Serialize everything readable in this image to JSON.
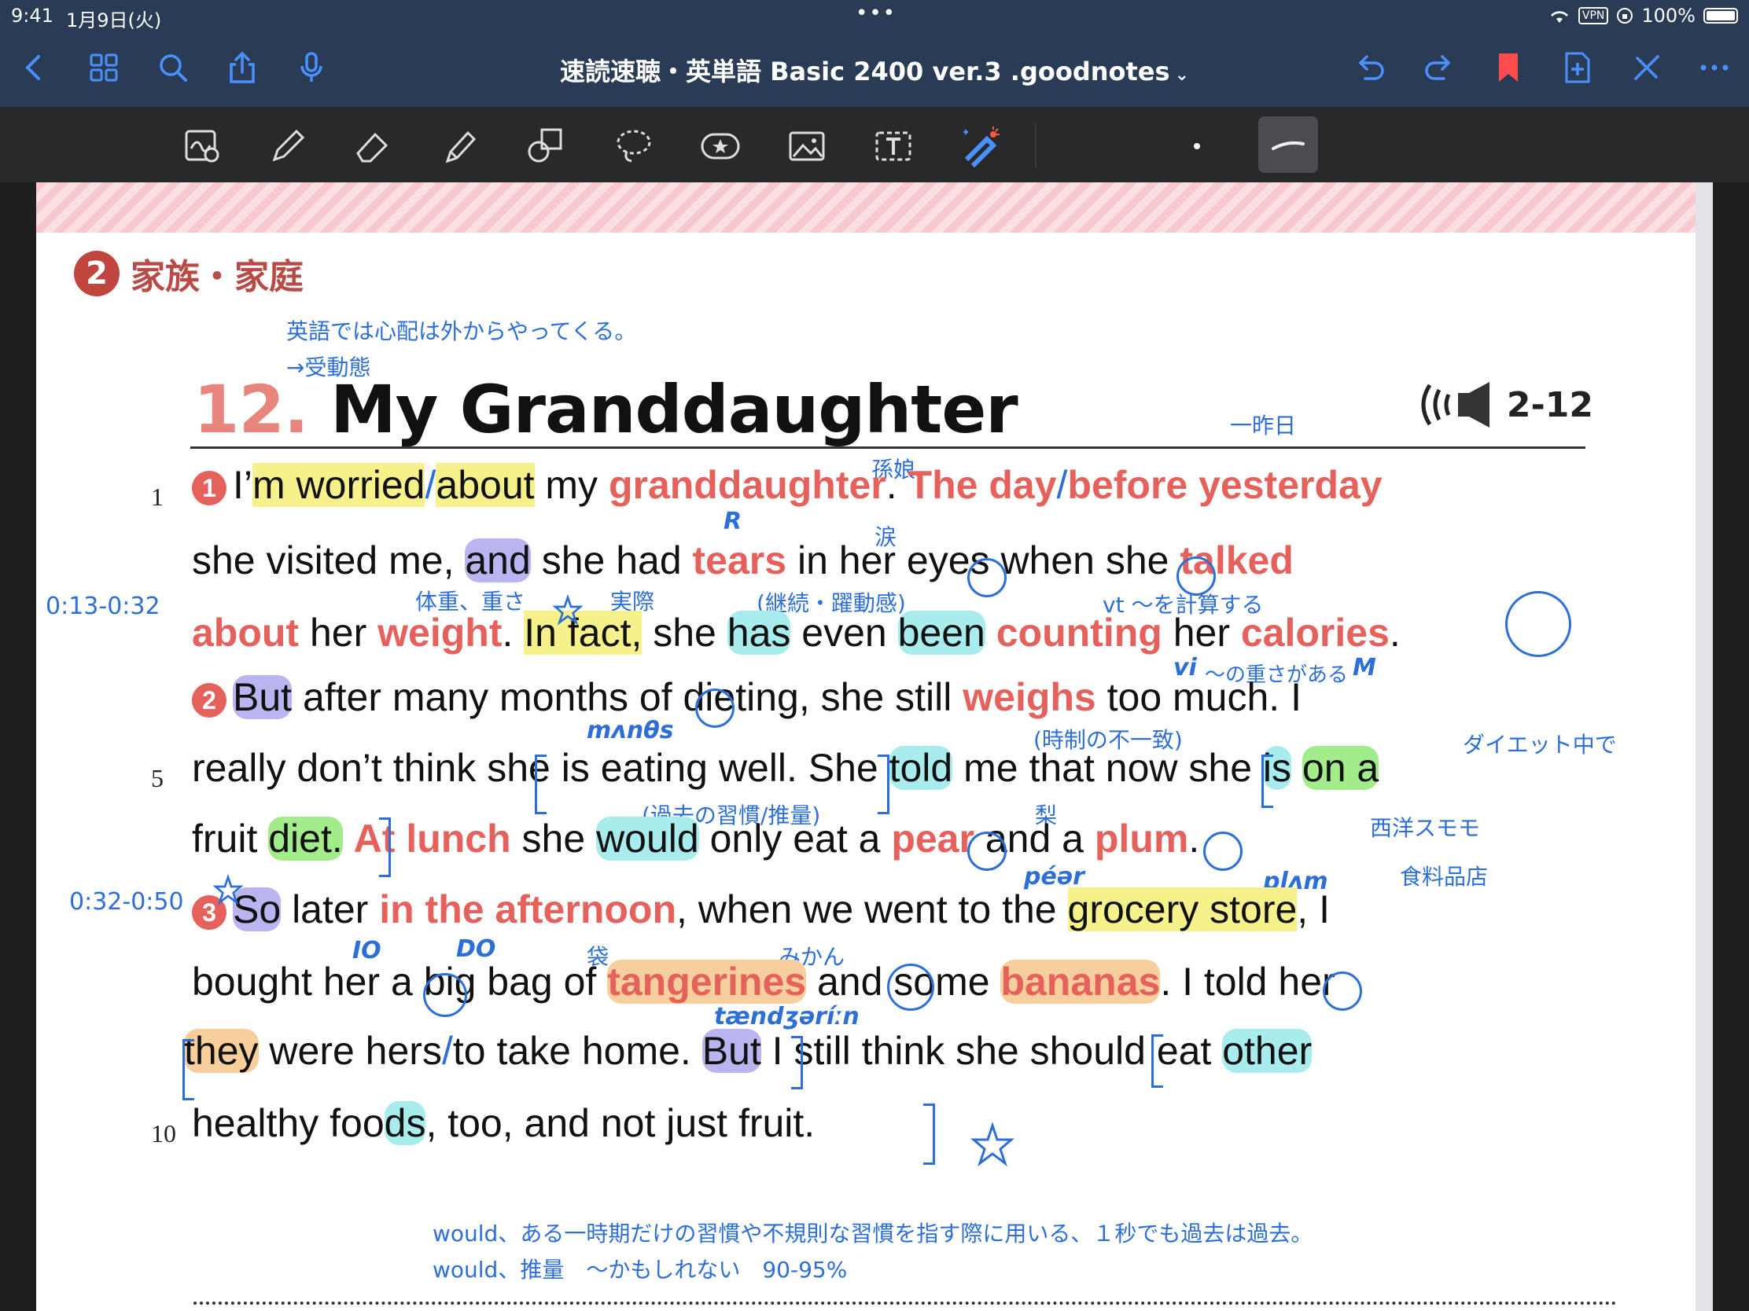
{
  "status": {
    "time": "9:41",
    "date": "1月9日(火)",
    "dots": "•••",
    "vpn": "VPN",
    "battery": "100%"
  },
  "nav": {
    "title": "速読速聴・英単語 Basic 2400 ver.3 .goodnotes",
    "title_chevron": "⌄"
  },
  "colors": {
    "accent": "#4a90ff",
    "bookmark": "#ff4d4d",
    "note_blue": "#2d6fd6",
    "red_word": "#e5615c"
  },
  "page": {
    "section_number": "2",
    "section_title": "家族・家庭",
    "note_top1": "英語では心配は外からやってくる。",
    "note_top2": "→受動態",
    "lesson_number": "12.",
    "lesson_title": "My Granddaughter",
    "audio_label": "2-12",
    "note_ototoi": "一昨日",
    "note_magomusume": "孫娘",
    "note_namida": "涙",
    "note_taiju": "体重、重さ",
    "note_jissai": "実際",
    "note_keizoku": "(継続・躍動感)",
    "note_keisan": "vt ～を計算する",
    "note_omosa": "～の重さがある",
    "note_jisei": "(時制の不一致)",
    "note_diet": "ダイエット中で",
    "note_kako": "(過去の習慣/推量)",
    "note_nashi": "梨",
    "note_sumomo": "西洋スモモ",
    "note_shokuryo": "食料品店",
    "note_fukuro": "袋",
    "note_mikan": "みかん",
    "time_a": "0:13-0:32",
    "time_b": "0:32-0:50",
    "hand_r": "R",
    "hand_vi": "vi",
    "hand_m": "M",
    "hand_months": "mʌnθs",
    "hand_pear": "péər",
    "hand_plum": "plʌm",
    "hand_io": "IO",
    "hand_do": "DO",
    "hand_tang": "tændʒəríːn",
    "bottom_note1": "would、ある一時期だけの習慣や不規則な習慣を指す際に用いる、１秒でも過去は過去。",
    "bottom_note2": "would、推量　～かもしれない　90-95%",
    "line_numbers": [
      "1",
      "5",
      "10"
    ]
  },
  "text": {
    "l1": [
      "I’",
      "m worried",
      "/",
      "about",
      " my ",
      "grand",
      "daughter",
      ".  ",
      "The day",
      "/",
      "before yesterday"
    ],
    "l2": [
      "she visited me, ",
      "and",
      " she had ",
      "tears",
      " in her eyes",
      " when she ",
      "talked"
    ],
    "l3": [
      "about",
      " her ",
      "weight",
      ". ",
      "In fact,",
      " she ",
      "has",
      " even ",
      "been",
      " ",
      "counting",
      " her ",
      "calories",
      "."
    ],
    "l4": [
      "But",
      " after many months of dieting, she still ",
      "weighs",
      " too much.  I"
    ],
    "l5": [
      "really don’t think ",
      "she is eating well",
      ".  She ",
      "told",
      " me that ",
      "now she ",
      "is",
      " ",
      "on a"
    ],
    "l6": [
      "fruit ",
      "diet.",
      " ",
      "At lunch",
      " she ",
      "would",
      " only eat ",
      "a",
      " ",
      "pear",
      " and ",
      "a",
      " ",
      "plum",
      "."
    ],
    "l7": [
      "So",
      " later ",
      "in the afternoon",
      ", when we went to the ",
      "grocery store",
      ", I"
    ],
    "l8": [
      "bought her ",
      "a",
      " big bag of ",
      "tangerines",
      " and some ",
      "bananas",
      ".  I told her"
    ],
    "l9": [
      "they",
      " were hers",
      "/",
      "to take home",
      ".  ",
      "But",
      " I still think ",
      "she should eat ",
      "other"
    ],
    "l10": [
      "healthy foo",
      "ds",
      ", too, and not just fruit."
    ]
  }
}
